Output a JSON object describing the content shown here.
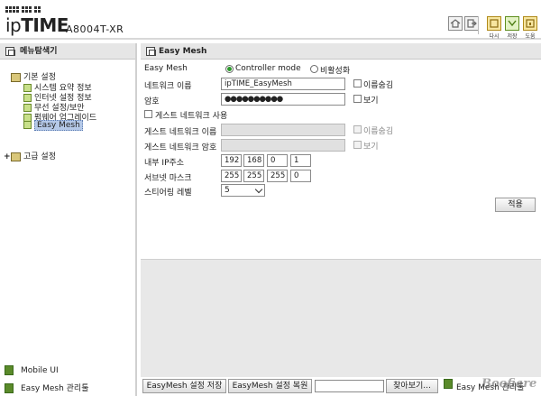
{
  "header": {
    "brand_prefix": "ip",
    "brand_main": "TIME",
    "model": "A8004T-XR",
    "buttons": [
      {
        "icon": "home-icon",
        "label": ""
      },
      {
        "icon": "logout-icon",
        "label": ""
      },
      {
        "icon": "refresh-icon",
        "label": "다시"
      },
      {
        "icon": "save-icon",
        "label": "저장"
      },
      {
        "icon": "help-icon",
        "label": "도움"
      }
    ]
  },
  "sidebar": {
    "title": "메뉴탐색기",
    "basic_settings": "기본 설정",
    "items": [
      {
        "label": "시스템 요약 정보"
      },
      {
        "label": "인터넷 설정 정보"
      },
      {
        "label": "무선 설정/보안"
      },
      {
        "label": "펌웨어 업그레이드"
      },
      {
        "label": "Easy Mesh"
      }
    ],
    "advanced_settings": "고급 설정",
    "links": [
      {
        "label": "Mobile UI"
      },
      {
        "label": "Easy Mesh 관리툴"
      }
    ]
  },
  "main": {
    "title": "Easy Mesh",
    "easy_mesh_label": "Easy Mesh",
    "mode_controller": "Controller mode",
    "mode_disabled": "비활성화",
    "network_name_label": "네트워크 이름",
    "network_name_value": "ipTIME_EasyMesh",
    "hide_name_label": "이름숨김",
    "password_label": "암호",
    "password_value": "●●●●●●●●●●",
    "show_label": "보기",
    "guest_use_label": "게스트 네트워크 사용",
    "guest_name_label": "게스트 네트워크 이름",
    "guest_hide_label": "이름숨김",
    "guest_password_label": "게스트 네트워크 암호",
    "guest_show_label": "보기",
    "internal_ip_label": "내부 IP주소",
    "internal_ip": [
      "192",
      "168",
      "0",
      "1"
    ],
    "subnet_mask_label": "서브넷 마스크",
    "subnet_mask": [
      "255",
      "255",
      "255",
      "0"
    ],
    "steering_label": "스티어링 레벨",
    "steering_value": "5",
    "apply_label": "적용"
  },
  "bottom": {
    "save_settings": "EasyMesh 설정 저장",
    "restore_settings": "EasyMesh 설정 복원",
    "browse": "찾아보기...",
    "mesh_link": "Easy Mesh 관리툴",
    "watermark": "Boofiare"
  }
}
